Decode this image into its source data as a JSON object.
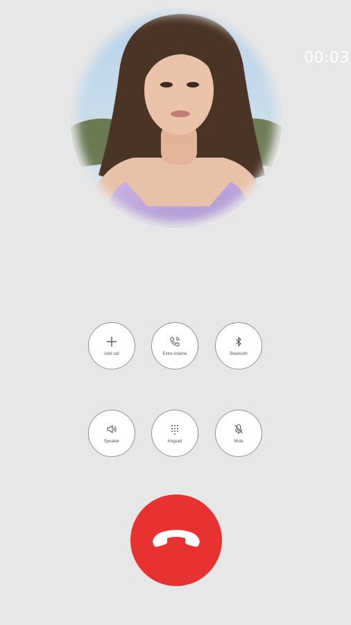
{
  "call": {
    "timer": "00:03"
  },
  "controls": [
    {
      "label": "Add call",
      "icon": "plus-icon"
    },
    {
      "label": "Extra volume",
      "icon": "phone-volume-icon"
    },
    {
      "label": "Bluetooth",
      "icon": "bluetooth-icon"
    },
    {
      "label": "Speaker",
      "icon": "speaker-icon"
    },
    {
      "label": "Keypad",
      "icon": "keypad-icon"
    },
    {
      "label": "Mute",
      "icon": "mic-off-icon"
    }
  ],
  "end_call": {
    "icon": "end-call-icon",
    "color": "#e83232"
  },
  "colors": {
    "background": "#e7e7e7",
    "timer_text": "#ffffff",
    "button_border": "#8f8f8f"
  }
}
